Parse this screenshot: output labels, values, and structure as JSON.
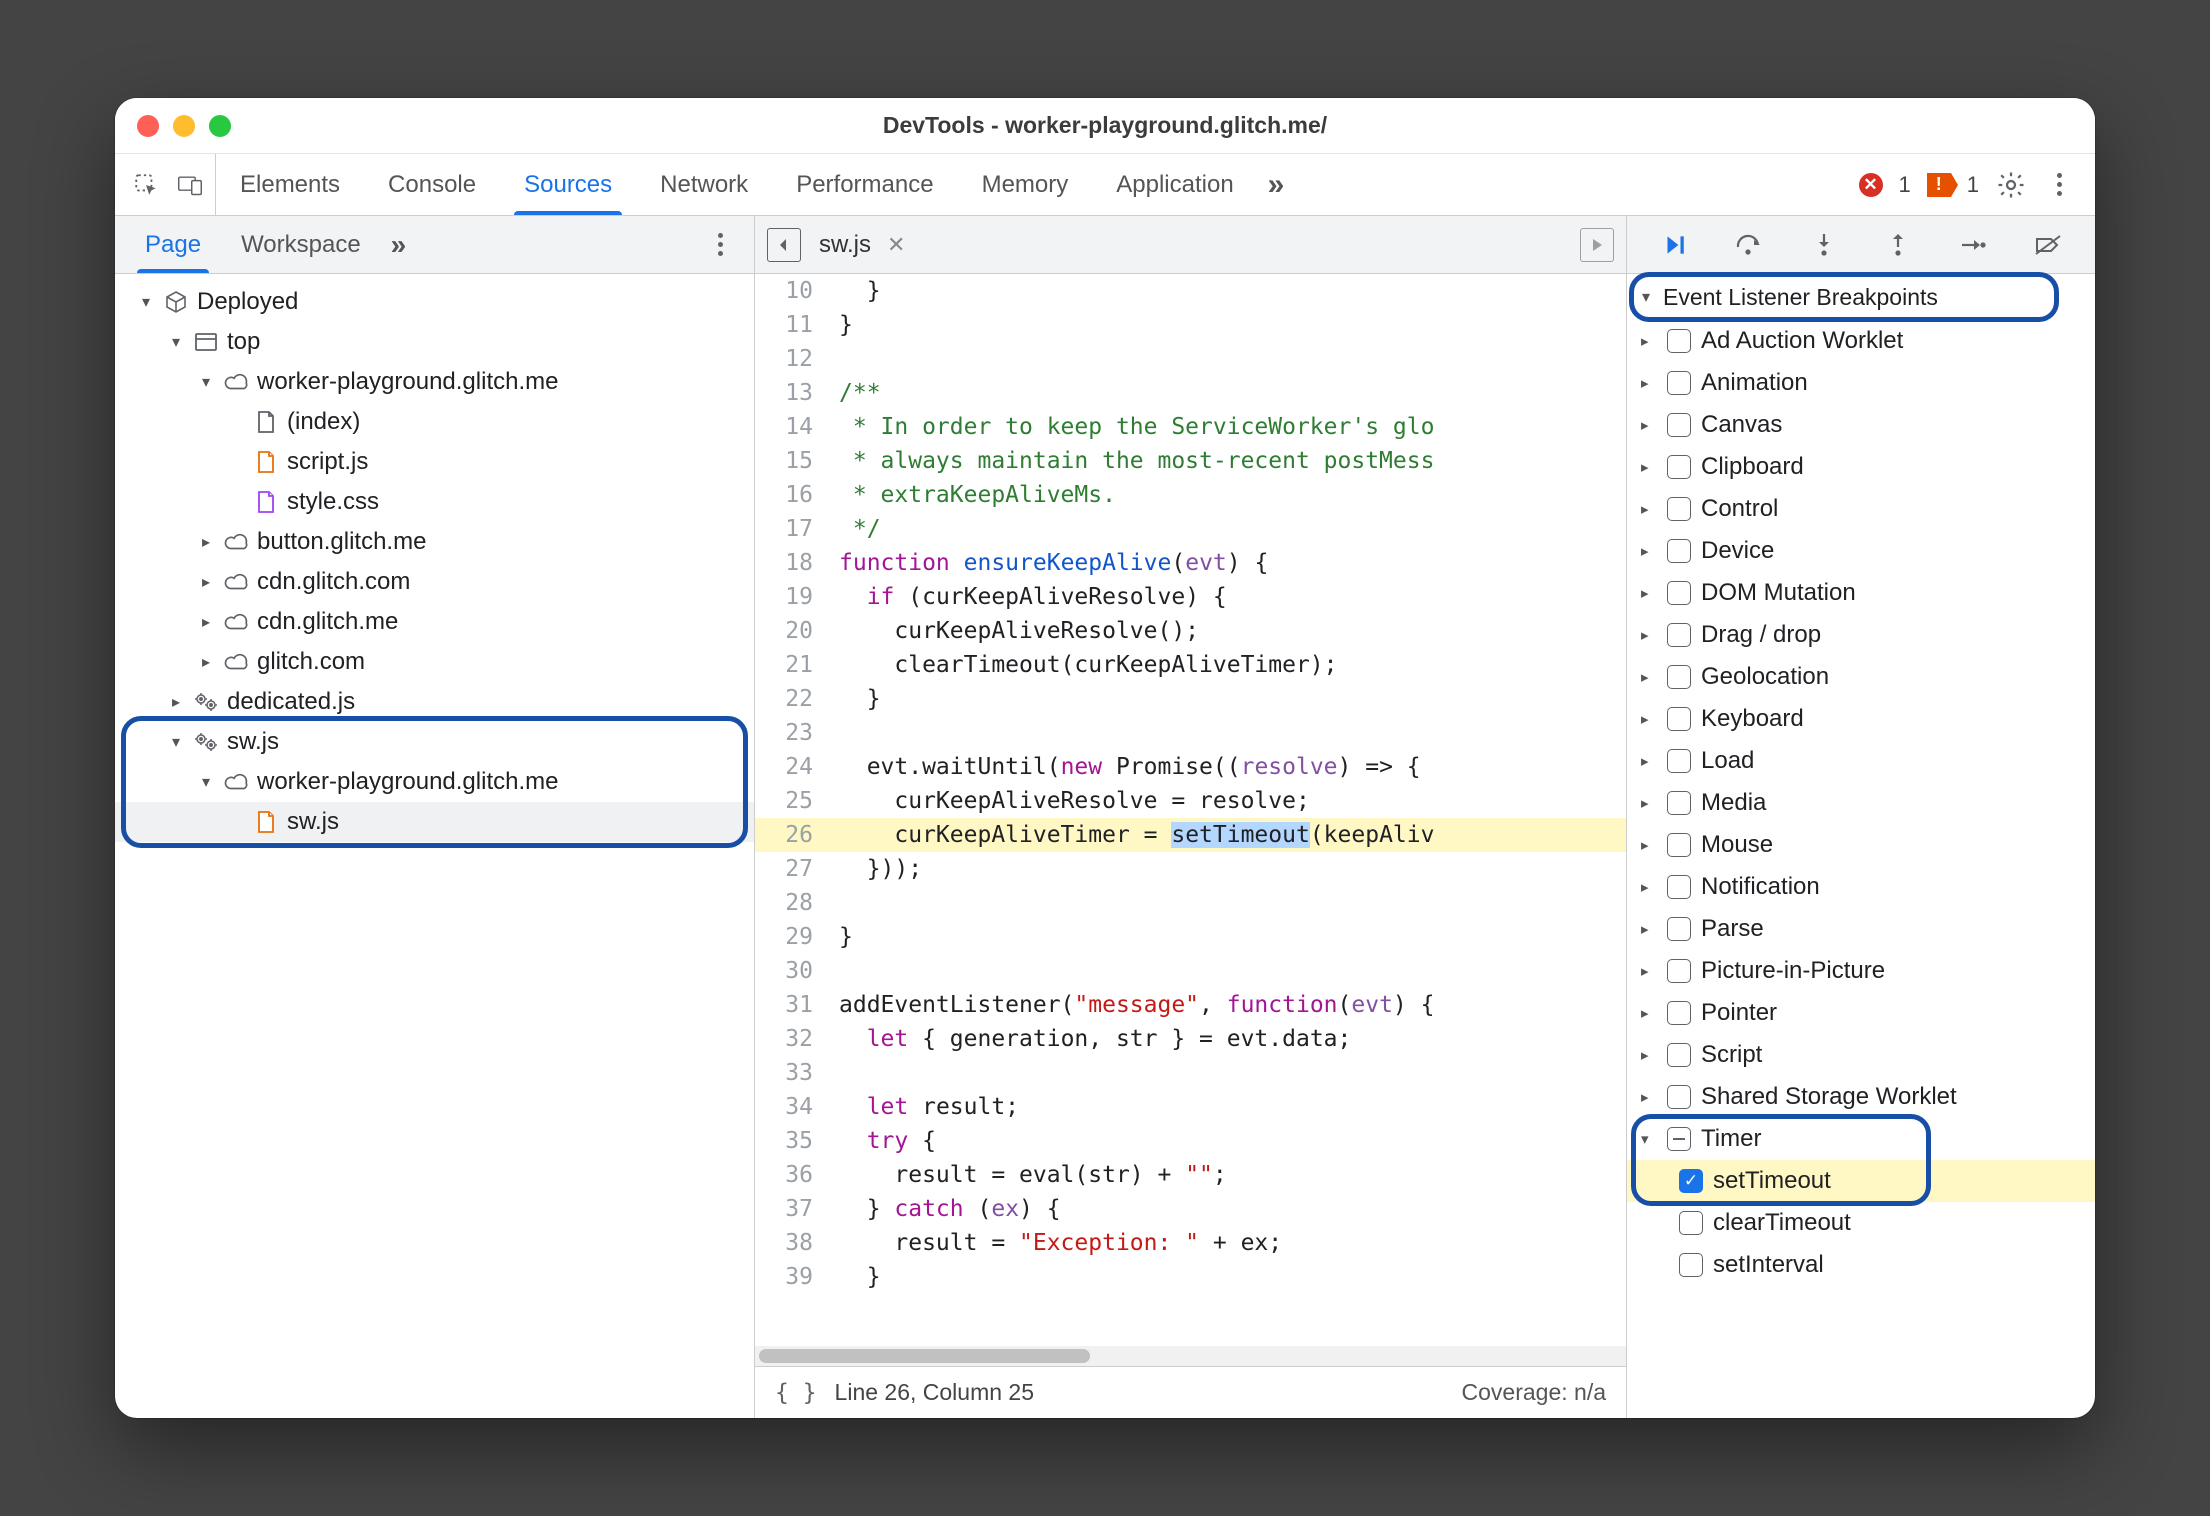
{
  "window": {
    "title": "DevTools - worker-playground.glitch.me/"
  },
  "toolbar": {
    "tabs": [
      "Elements",
      "Console",
      "Sources",
      "Network",
      "Performance",
      "Memory",
      "Application"
    ],
    "active_index": 2,
    "more_glyph": "»",
    "errors_count": "1",
    "issues_count": "1"
  },
  "navigator": {
    "tabs": [
      "Page",
      "Workspace"
    ],
    "active_index": 0,
    "more_glyph": "»",
    "tree": [
      {
        "depth": 0,
        "arrow": "open",
        "icon": "cube",
        "label": "Deployed"
      },
      {
        "depth": 1,
        "arrow": "open",
        "icon": "frame",
        "label": "top"
      },
      {
        "depth": 2,
        "arrow": "open",
        "icon": "cloud",
        "label": "worker-playground.glitch.me"
      },
      {
        "depth": 3,
        "arrow": "none",
        "icon": "file-blank",
        "label": "(index)"
      },
      {
        "depth": 3,
        "arrow": "none",
        "icon": "file-orange",
        "label": "script.js"
      },
      {
        "depth": 3,
        "arrow": "none",
        "icon": "file-purple",
        "label": "style.css"
      },
      {
        "depth": 2,
        "arrow": "closed",
        "icon": "cloud",
        "label": "button.glitch.me"
      },
      {
        "depth": 2,
        "arrow": "closed",
        "icon": "cloud",
        "label": "cdn.glitch.com"
      },
      {
        "depth": 2,
        "arrow": "closed",
        "icon": "cloud",
        "label": "cdn.glitch.me"
      },
      {
        "depth": 2,
        "arrow": "closed",
        "icon": "cloud",
        "label": "glitch.com"
      },
      {
        "depth": 1,
        "arrow": "closed",
        "icon": "gears",
        "label": "dedicated.js"
      },
      {
        "depth": 1,
        "arrow": "open",
        "icon": "gears",
        "label": "sw.js"
      },
      {
        "depth": 2,
        "arrow": "open",
        "icon": "cloud",
        "label": "worker-playground.glitch.me"
      },
      {
        "depth": 3,
        "arrow": "none",
        "icon": "file-orange",
        "label": "sw.js",
        "selected": true
      }
    ]
  },
  "editor": {
    "open_file": "sw.js",
    "status_line": "Line 26, Column 25",
    "coverage": "Coverage: n/a",
    "highlight_line": 26,
    "lines": [
      {
        "n": 10,
        "html": "  }"
      },
      {
        "n": 11,
        "html": "}"
      },
      {
        "n": 12,
        "html": ""
      },
      {
        "n": 13,
        "html": "<span class='tok-com'>/**</span>"
      },
      {
        "n": 14,
        "html": "<span class='tok-com'> * In order to keep the ServiceWorker's glo</span>"
      },
      {
        "n": 15,
        "html": "<span class='tok-com'> * always maintain the most-recent postMess</span>"
      },
      {
        "n": 16,
        "html": "<span class='tok-com'> * extraKeepAliveMs.</span>"
      },
      {
        "n": 17,
        "html": "<span class='tok-com'> */</span>"
      },
      {
        "n": 18,
        "html": "<span class='tok-kw'>function</span> <span class='tok-fn'>ensureKeepAlive</span>(<span class='tok-prm'>evt</span>) {"
      },
      {
        "n": 19,
        "html": "  <span class='tok-kw'>if</span> (curKeepAliveResolve) {"
      },
      {
        "n": 20,
        "html": "    curKeepAliveResolve();"
      },
      {
        "n": 21,
        "html": "    clearTimeout(curKeepAliveTimer);"
      },
      {
        "n": 22,
        "html": "  }"
      },
      {
        "n": 23,
        "html": ""
      },
      {
        "n": 24,
        "html": "  evt.waitUntil(<span class='tok-new'>new</span> Promise((<span class='tok-prm'>resolve</span>) =&gt; {"
      },
      {
        "n": 25,
        "html": "    curKeepAliveResolve = resolve;"
      },
      {
        "n": 26,
        "html": "    curKeepAliveTimer = <span class='sel'>setTimeout</span>(keepAliv"
      },
      {
        "n": 27,
        "html": "  }));"
      },
      {
        "n": 28,
        "html": ""
      },
      {
        "n": 29,
        "html": "}"
      },
      {
        "n": 30,
        "html": ""
      },
      {
        "n": 31,
        "html": "addEventListener(<span class='tok-str'>\"message\"</span>, <span class='tok-kw'>function</span>(<span class='tok-prm'>evt</span>) {"
      },
      {
        "n": 32,
        "html": "  <span class='tok-kw'>let</span> { generation, str } = evt.data;"
      },
      {
        "n": 33,
        "html": ""
      },
      {
        "n": 34,
        "html": "  <span class='tok-kw'>let</span> result;"
      },
      {
        "n": 35,
        "html": "  <span class='tok-kw'>try</span> {"
      },
      {
        "n": 36,
        "html": "    result = eval(str) + <span class='tok-str'>\"\"</span>;"
      },
      {
        "n": 37,
        "html": "  } <span class='tok-kw'>catch</span> (<span class='tok-prm'>ex</span>) {"
      },
      {
        "n": 38,
        "html": "    result = <span class='tok-str'>\"Exception: \"</span> + ex;"
      },
      {
        "n": 39,
        "html": "  }"
      }
    ]
  },
  "debugger": {
    "section_title": "Event Listener Breakpoints",
    "categories": [
      {
        "label": "Ad Auction Worklet",
        "open": false,
        "state": "off"
      },
      {
        "label": "Animation",
        "open": false,
        "state": "off"
      },
      {
        "label": "Canvas",
        "open": false,
        "state": "off"
      },
      {
        "label": "Clipboard",
        "open": false,
        "state": "off"
      },
      {
        "label": "Control",
        "open": false,
        "state": "off"
      },
      {
        "label": "Device",
        "open": false,
        "state": "off"
      },
      {
        "label": "DOM Mutation",
        "open": false,
        "state": "off"
      },
      {
        "label": "Drag / drop",
        "open": false,
        "state": "off"
      },
      {
        "label": "Geolocation",
        "open": false,
        "state": "off"
      },
      {
        "label": "Keyboard",
        "open": false,
        "state": "off"
      },
      {
        "label": "Load",
        "open": false,
        "state": "off"
      },
      {
        "label": "Media",
        "open": false,
        "state": "off"
      },
      {
        "label": "Mouse",
        "open": false,
        "state": "off"
      },
      {
        "label": "Notification",
        "open": false,
        "state": "off"
      },
      {
        "label": "Parse",
        "open": false,
        "state": "off"
      },
      {
        "label": "Picture-in-Picture",
        "open": false,
        "state": "off"
      },
      {
        "label": "Pointer",
        "open": false,
        "state": "off"
      },
      {
        "label": "Script",
        "open": false,
        "state": "off"
      },
      {
        "label": "Shared Storage Worklet",
        "open": false,
        "state": "off"
      },
      {
        "label": "Timer",
        "open": true,
        "state": "ind",
        "children": [
          {
            "label": "setTimeout",
            "state": "on",
            "hl": true
          },
          {
            "label": "clearTimeout",
            "state": "off"
          },
          {
            "label": "setInterval",
            "state": "off"
          }
        ]
      }
    ]
  }
}
